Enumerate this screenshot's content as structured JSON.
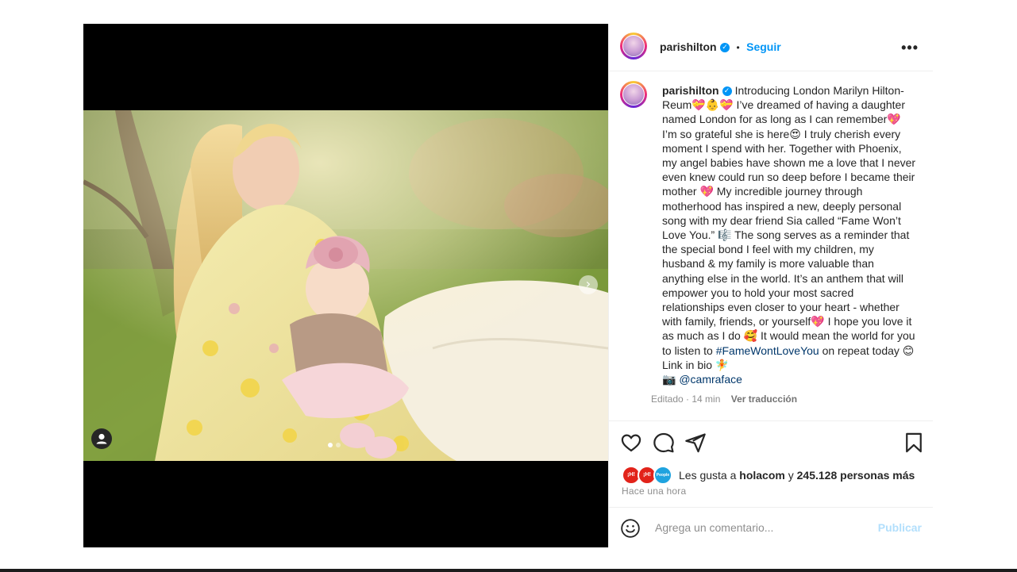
{
  "header": {
    "username": "parishilton",
    "verified_mark": "✓",
    "separator": "•",
    "follow_label": "Seguir",
    "more_label": "•••"
  },
  "media": {
    "next_arrow": "›",
    "user_tag_icon": "person-icon",
    "slide_count": 2,
    "active_slide": 1
  },
  "caption": {
    "username": "parishilton",
    "text_1": "Introducing London Marilyn Hilton-Reum💝👶💝 I’ve dreamed of having a daughter named London for as long as I can remember💖 I’m so grateful she is here😍 I truly cherish every moment I spend with her. Together with Phoenix, my angel babies have shown me a love that I never even knew could run so deep before I became their mother 💖 My incredible journey through motherhood has inspired a new, deeply personal song with my dear friend Sia called “Fame Won’t Love You.” 🎼 The song serves as a reminder that the special bond I feel with my children, my husband & my family is more valuable than anything else in the world. It’s an anthem that will empower you to hold your most sacred relationships even closer to your heart - whether with family, friends, or yourself💖 I hope you love it as much as I do 🥰 It would mean the world for you to listen to",
    "hashtag": "#FameWontLoveYou",
    "text_2": "on repeat today 😊 Link in bio 🧚",
    "camera": "📷",
    "mention": "@camraface",
    "edited": "Editado · 14 min",
    "translate": "Ver traducción"
  },
  "actions": {
    "like_icon": "heart-icon",
    "comment_icon": "comment-icon",
    "share_icon": "send-icon",
    "save_icon": "bookmark-icon"
  },
  "likes": {
    "avatars": [
      {
        "label": "¡H!",
        "color": "#e2231a"
      },
      {
        "label": "¡H!",
        "color": "#e2231a"
      },
      {
        "label": "People",
        "color": "#1fa3df"
      }
    ],
    "prefix": "Les gusta a",
    "user": "holacom",
    "joiner": "y",
    "others": "245.128 personas más"
  },
  "time_ago": "Hace una hora",
  "comment": {
    "emoji_icon": "smiley-icon",
    "placeholder": "Agrega un comentario...",
    "publish_label": "Publicar"
  }
}
